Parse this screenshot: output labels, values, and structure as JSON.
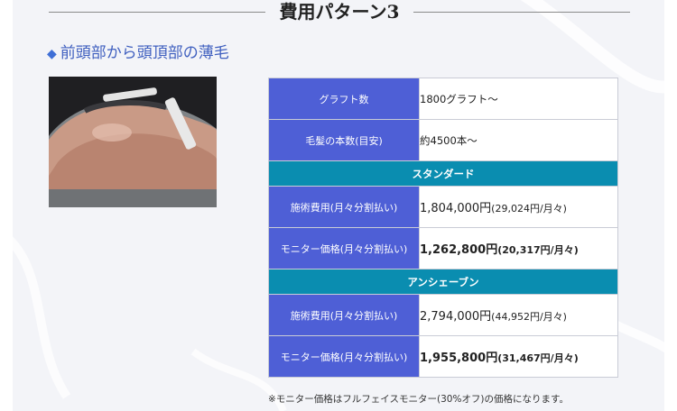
{
  "heading": {
    "title": "費用パターン3"
  },
  "subheading": {
    "icon": "diamond-icon",
    "text": "前頭部から頭頂部の薄毛"
  },
  "photo": {
    "alt": "front-scalp-photo"
  },
  "table": {
    "row1": {
      "label": "グラフト数",
      "value": "1800グラフト〜"
    },
    "row2": {
      "label": "毛髪の本数(目安)",
      "value": "約4500本〜"
    },
    "standard": {
      "title": "スタンダード",
      "fee_label": "施術費用(月々分割払い)",
      "fee_main": "1,804,000円",
      "fee_sub": "(29,024円/月々)",
      "monitor_label": "モニター価格(月々分割払い)",
      "monitor_main": "1,262,800円",
      "monitor_sub": "(20,317円/月々)"
    },
    "unshaven": {
      "title": "アンシェーブン",
      "fee_label": "施術費用(月々分割払い)",
      "fee_main": "2,794,000円",
      "fee_sub": "(44,952円/月々)",
      "monitor_label": "モニター価格(月々分割払い)",
      "monitor_main": "1,955,800円",
      "monitor_sub": "(31,467円/月々)"
    }
  },
  "note": "※モニター価格はフルフェイスモニター(30%オフ)の価格になります。",
  "colors": {
    "label_bg": "#4e5fd6",
    "section_bg": "#0a8db0",
    "accent": "#3f5fbf"
  }
}
